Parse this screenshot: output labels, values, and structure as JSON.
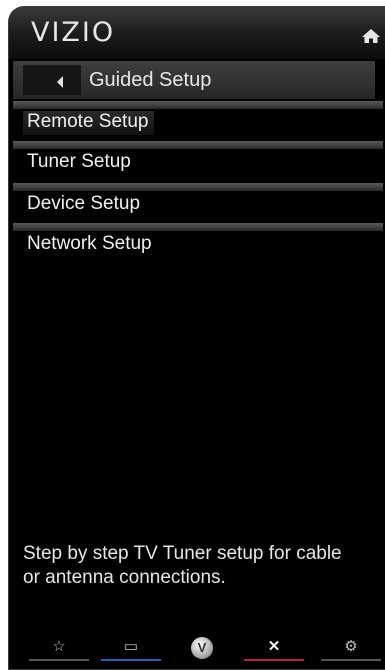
{
  "header": {
    "brand": "VIZIO"
  },
  "nav": {
    "title": "Guided Setup"
  },
  "menu": {
    "items": [
      {
        "label": "Remote Setup"
      },
      {
        "label": "Tuner Setup"
      },
      {
        "label": "Device Setup"
      },
      {
        "label": "Network Setup"
      }
    ]
  },
  "description": "Step by step TV Tuner setup for cable or antenna connections.",
  "bottom_buttons": [
    {
      "icon": "star-icon",
      "color": "#555555"
    },
    {
      "icon": "screen-icon",
      "color": "#2a5fb0"
    },
    {
      "icon": "vizio-logo-icon"
    },
    {
      "icon": "close-icon",
      "color": "#b0283c"
    },
    {
      "icon": "gear-icon",
      "color": "#555555"
    }
  ]
}
